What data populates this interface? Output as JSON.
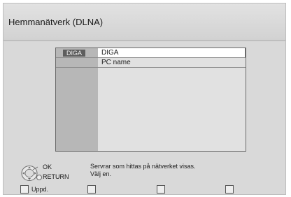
{
  "header": {
    "title": "Hemmanätverk (DLNA)"
  },
  "list": {
    "rows": [
      {
        "tag": "DIGA",
        "name": "DIGA",
        "selected": true
      },
      {
        "tag": "",
        "name": "PC name",
        "selected": false
      }
    ]
  },
  "footer": {
    "ok_label": "OK",
    "return_label": "RETURN",
    "message_line1": "Servrar som hittas på nätverket visas.",
    "message_line2": "Välj en.",
    "buttons": [
      {
        "label": "Uppd.",
        "icon": "color-button-icon"
      },
      {
        "label": "",
        "icon": "color-button-icon"
      },
      {
        "label": "",
        "icon": "color-button-icon"
      },
      {
        "label": "",
        "icon": "color-button-icon"
      }
    ]
  },
  "colors": {
    "background": "#d9d9d9",
    "selected_row": "#ffffff",
    "tag_bg": "#5e5e5e"
  }
}
